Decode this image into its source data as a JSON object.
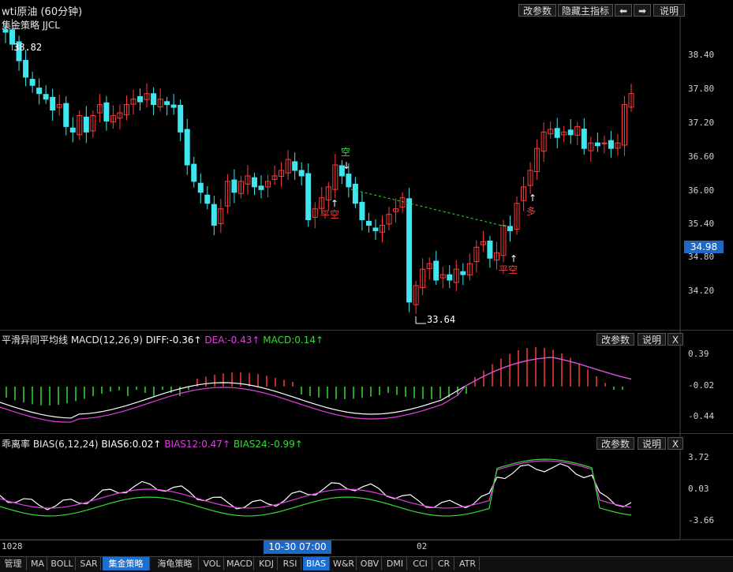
{
  "window": {
    "title": "wti原油 (60分钟)",
    "buttons": [
      "改参数",
      "隐藏主指标",
      "⬅",
      "➡",
      "说明"
    ]
  },
  "main_chart": {
    "indicator_name": "集金策略 JJCL",
    "price_label": "34.98",
    "high_label": "38.82",
    "low_label": "33.64",
    "y_ticks": [
      "38.40",
      "37.80",
      "37.20",
      "36.60",
      "36.00",
      "35.40",
      "34.80",
      "34.20"
    ],
    "signals": {
      "kong": "空",
      "pingkong1": "平空",
      "pingkong2": "平空",
      "duo": "多"
    }
  },
  "macd_panel": {
    "title": "平滑异同平均线 MACD(12,26,9)",
    "diff": "DIFF:-0.36↑",
    "dea": "DEA:-0.43↑",
    "macd": "MACD:0.14↑",
    "buttons": [
      "改参数",
      "说明",
      "X"
    ],
    "y_ticks": [
      "0.39",
      "-0.02",
      "-0.44"
    ]
  },
  "bias_panel": {
    "title": "乖离率 BIAS(6,12,24)",
    "bias6": "BIAS6:0.02↑",
    "bias12": "BIAS12:0.47↑",
    "bias24": "BIAS24:-0.99↑",
    "buttons": [
      "改参数",
      "说明",
      "X"
    ],
    "y_ticks": [
      "3.72",
      "0.03",
      "-3.66"
    ]
  },
  "time_axis": {
    "left": "1028",
    "cursor": "10-30 07:00",
    "mid": "02"
  },
  "tabs": [
    {
      "label": "管理",
      "w": 34
    },
    {
      "label": "MA",
      "w": 24
    },
    {
      "label": "BOLL",
      "w": 34
    },
    {
      "label": "SAR",
      "w": 30
    },
    {
      "label": "集金策略",
      "w": 60,
      "active": true
    },
    {
      "label": "海龟策略",
      "w": 60
    },
    {
      "label": "VOL",
      "w": 30
    },
    {
      "label": "MACD",
      "w": 36
    },
    {
      "label": "KDJ",
      "w": 28
    },
    {
      "label": "RSI",
      "w": 28
    },
    {
      "label": "BIAS",
      "w": 34,
      "active": true
    },
    {
      "label": "W&R",
      "w": 32
    },
    {
      "label": "OBV",
      "w": 30
    },
    {
      "label": "DMI",
      "w": 30
    },
    {
      "label": "CCI",
      "w": 30
    },
    {
      "label": "CR",
      "w": 26
    },
    {
      "label": "ATR",
      "w": 30
    }
  ],
  "colors": {
    "up": "#ff3b3b",
    "down": "#3fe6ef",
    "white": "#ffffff",
    "magenta": "#e040e0",
    "green": "#33dd33",
    "axis": "#dddddd"
  }
}
